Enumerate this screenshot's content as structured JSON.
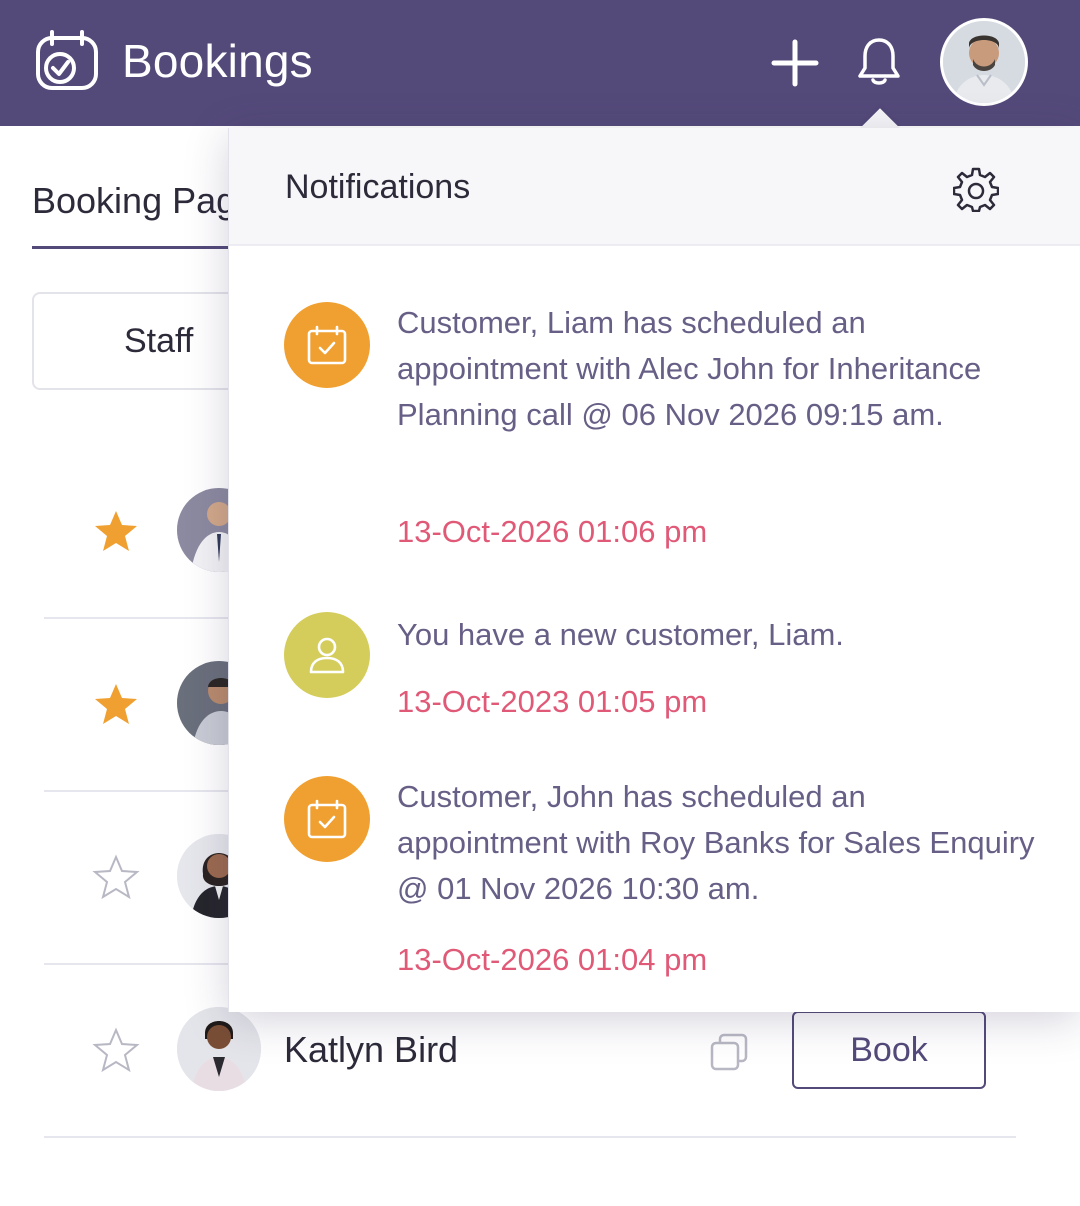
{
  "header": {
    "title": "Bookings",
    "icons": {
      "logo": "calendar-check-icon",
      "add": "plus-icon",
      "notifications": "bell-icon",
      "profile": "avatar"
    }
  },
  "page": {
    "tab_label": "Booking Pag",
    "filter_label": "Staff",
    "rows": [
      {
        "name": "",
        "starred": true
      },
      {
        "name": "",
        "starred": true
      },
      {
        "name": "",
        "starred": false
      },
      {
        "name": "Katlyn Bird",
        "starred": false,
        "book_label": "Book"
      }
    ]
  },
  "notifications": {
    "title": "Notifications",
    "items": [
      {
        "icon": "calendar-check-icon",
        "color": "#f0a030",
        "text": "Customer, Liam has scheduled an appointment with Alec John for Inheritance Planning call @ 06 Nov 2026 09:15 am.",
        "time": "13-Oct-2026 01:06 pm"
      },
      {
        "icon": "user-icon",
        "color": "#d4cd5c",
        "text": "You have a new customer, Liam.",
        "time": "13-Oct-2023 01:05 pm"
      },
      {
        "icon": "calendar-check-icon",
        "color": "#f0a030",
        "text": "Customer, John has scheduled an appointment with Roy Banks for Sales Enquiry @ 01 Nov 2026 10:30 am.",
        "time": "13-Oct-2026 01:04 pm"
      }
    ]
  },
  "colors": {
    "header_bg": "#544a7a",
    "star_filled": "#f0a030",
    "time_text": "#e05a78",
    "notif_text": "#675f86"
  }
}
